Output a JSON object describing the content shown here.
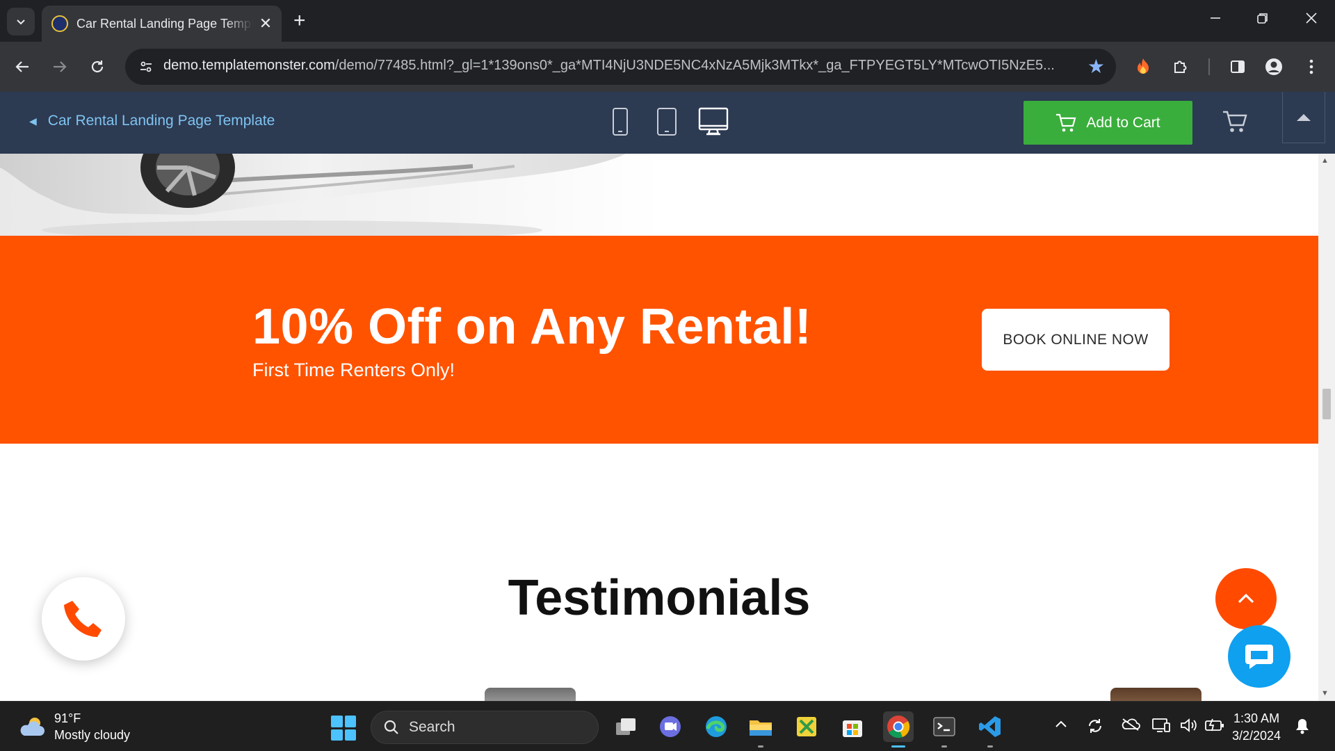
{
  "browser": {
    "tab_title": "Car Rental Landing Page Template",
    "new_tab_symbol": "+",
    "close_symbol": "✕",
    "url_host": "demo.templatemonster.com",
    "url_path": "/demo/77485.html?_gl=1*139ons0*_ga*MTI4NjU3NDE5NC4xNzA5Mjk3MTkx*_ga_FTPYEGT5LY*MTcwOTI5NzE5..."
  },
  "preview_bar": {
    "back_label": "Car Rental Landing Page Template",
    "add_to_cart_label": "Add to Cart"
  },
  "page": {
    "promo_title": "10% Off on Any Rental!",
    "promo_subtitle": "First Time Renters Only!",
    "book_button": "BOOK ONLINE NOW",
    "section_heading": "Testimonials"
  },
  "colors": {
    "promo_orange": "#ff5300",
    "add_to_cart_green": "#3aae3c",
    "preview_bar": "#2c3a52",
    "chat_blue": "#0fa0f0"
  },
  "taskbar": {
    "weather_temp": "91°F",
    "weather_desc": "Mostly cloudy",
    "search_placeholder": "Search",
    "time": "1:30 AM",
    "date": "3/2/2024"
  },
  "icons": [
    "tab-search-icon",
    "favicon-icon",
    "back-arrow-icon",
    "forward-arrow-icon",
    "reload-icon",
    "site-info-icon",
    "bookmark-star-icon",
    "extension-fire-icon",
    "extensions-puzzle-icon",
    "side-panel-icon",
    "profile-icon",
    "kebab-menu-icon",
    "mobile-device-icon",
    "tablet-device-icon",
    "desktop-device-icon",
    "cart-icon",
    "collapse-arrow-icon",
    "phone-icon",
    "chevron-up-icon",
    "chat-icon",
    "weather-cloud-icon",
    "windows-start-icon",
    "search-icon",
    "bell-icon"
  ]
}
